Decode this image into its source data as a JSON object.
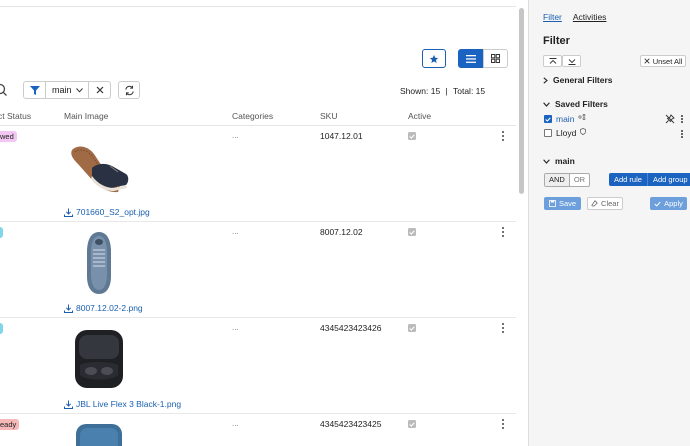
{
  "toolbar": {
    "filter_select_value": "main",
    "shown_label": "Shown: 15",
    "separator": "|",
    "total_label": "Total: 15"
  },
  "table": {
    "columns": [
      "ct Status",
      "Main Image",
      "Categories",
      "SKU",
      "Active"
    ],
    "rows": [
      {
        "status": "wed",
        "status_color": "#f2c8f2",
        "image_icon": "shoe-icon",
        "file": "701660_S2_opt.jpg",
        "categories": "...",
        "sku": "1047.12.01"
      },
      {
        "status": "",
        "status_color": "#7fd6ea",
        "image_icon": "sneaker-icon",
        "file": "8007.12.02-2.png",
        "categories": "...",
        "sku": "8007.12.02"
      },
      {
        "status": "",
        "status_color": "#7fd6ea",
        "image_icon": "earbuds-case-icon",
        "file": "JBL Live Flex 3 Black-1.png",
        "categories": "...",
        "sku": "4345423423426"
      },
      {
        "status": "eady",
        "status_color": "#f6b8b8",
        "image_icon": "earbuds-case-blue-icon",
        "file": "",
        "categories": "...",
        "sku": "4345423423425"
      }
    ]
  },
  "panel": {
    "tabs": [
      "Filter",
      "Activities"
    ],
    "title": "Filter",
    "unset_all": "Unset All",
    "general_filters": "General Filters",
    "saved_filters": "Saved Filters",
    "saved": [
      {
        "label": "main",
        "checked": true
      },
      {
        "label": "Lloyd",
        "checked": false
      }
    ],
    "group_title": "main",
    "and_label": "AND",
    "or_label": "OR",
    "add_rule": "Add rule",
    "add_group": "Add group",
    "save": "Save",
    "clear": "Clear",
    "apply": "Apply"
  },
  "colors": {
    "accent": "#1b63c0",
    "link": "#1b5fb0",
    "button_muted": "#6c9fdb"
  }
}
